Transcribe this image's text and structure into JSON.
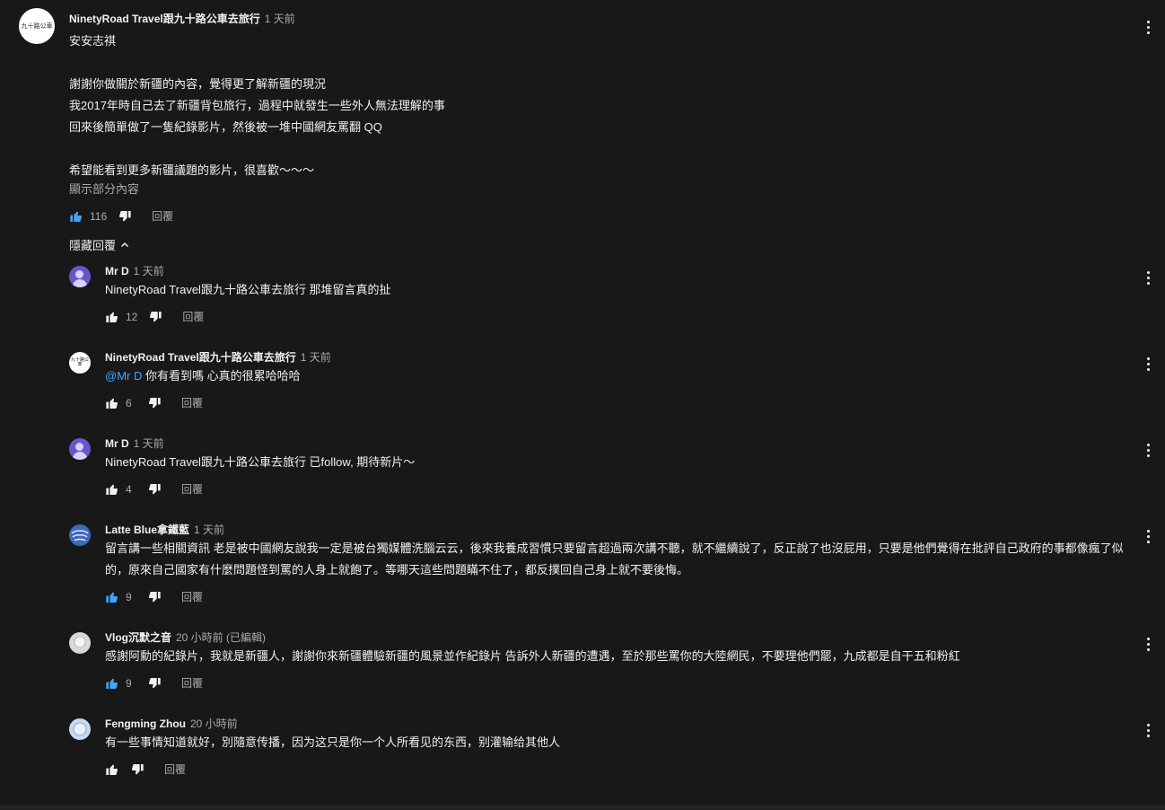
{
  "top_comment": {
    "author": "NinetyRoad Travel跟九十路公車去旅行",
    "time": "1 天前",
    "avatar_text": "九十路公車",
    "lines": [
      "安安志祺",
      "",
      "謝謝你做關於新疆的內容，覺得更了解新疆的現況",
      "我2017年時自己去了新疆背包旅行，過程中就發生一些外人無法理解的事",
      "回來後簡單做了一隻紀錄影片，然後被一堆中國網友罵翻 QQ",
      "",
      "希望能看到更多新疆議題的影片，很喜歡～～～"
    ],
    "show_more": "顯示部分內容",
    "likes": "116",
    "reply_label": "回覆"
  },
  "hide_replies_label": "隱藏回覆",
  "replies": [
    {
      "author": "Mr D",
      "time": "1 天前",
      "avatar": "person",
      "mention": "",
      "text": "NinetyRoad Travel跟九十路公車去旅行 那堆留言真的扯",
      "likes": "12",
      "liked": false,
      "reply_label": "回覆"
    },
    {
      "author": "NinetyRoad Travel跟九十路公車去旅行",
      "time": "1 天前",
      "avatar": "channel",
      "mention": "@Mr D",
      "text": " 你有看到嗎 心真的很累哈哈哈",
      "likes": "6",
      "liked": false,
      "reply_label": "回覆"
    },
    {
      "author": "Mr D",
      "time": "1 天前",
      "avatar": "person",
      "mention": "",
      "text": "NinetyRoad Travel跟九十路公車去旅行 已follow, 期待新片～",
      "likes": "4",
      "liked": false,
      "reply_label": "回覆"
    },
    {
      "author": "Latte Blue拿鐵藍",
      "time": "1 天前",
      "avatar": "latte",
      "mention": "",
      "text": "留言講一些相關資訊 老是被中國網友說我一定是被台獨媒體洗腦云云，後來我養成習慣只要留言超過兩次講不聽，就不繼續說了，反正說了也沒屁用，只要是他們覺得在批評自己政府的事都像瘋了似的，原來自己國家有什麼問題怪到罵的人身上就飽了。等哪天這些問題瞞不住了，都反撲回自己身上就不要後悔。",
      "likes": "9",
      "liked": true,
      "reply_label": "回覆"
    },
    {
      "author": "Vlog沉默之音",
      "time": "20 小時前 (已編輯)",
      "avatar": "vlog",
      "mention": "",
      "text": "感謝阿勳的紀錄片，我就是新疆人，謝謝你來新疆體驗新疆的風景並作紀錄片 告訴外人新疆的遭遇，至於那些罵你的大陸網民，不要理他們罷，九成都是自干五和粉紅",
      "likes": "9",
      "liked": true,
      "reply_label": "回覆"
    },
    {
      "author": "Fengming Zhou",
      "time": "20 小時前",
      "avatar": "feng",
      "mention": "",
      "text": "有一些事情知道就好，別隨意传播，因为这只是你一个人所看见的东西，别灌输给其他人",
      "likes": "",
      "liked": false,
      "reply_label": "回覆"
    }
  ],
  "colors": {
    "background": "#181818",
    "text": "#f1f1f1",
    "secondary": "#aaaaaa",
    "like_active": "#3ea6ff",
    "mention": "#3ea6ff"
  }
}
